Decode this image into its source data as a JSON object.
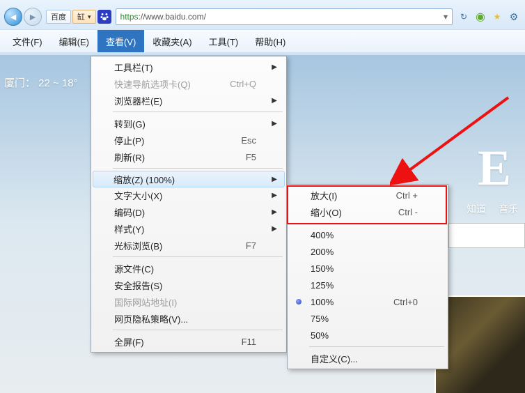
{
  "chrome": {
    "tab1": "百度",
    "tab2": "缸",
    "url_proto": "https",
    "url_rest": "://www.baidu.com/"
  },
  "menubar": {
    "file": "文件(F)",
    "edit": "编辑(E)",
    "view": "查看(V)",
    "fav": "收藏夹(A)",
    "tools": "工具(T)",
    "help": "帮助(H)"
  },
  "bg": {
    "weather": "厦门：    22 ~ 18°",
    "big_letter": "E",
    "link1": "知道",
    "link2": "音乐"
  },
  "viewMenu": {
    "toolbars": "工具栏(T)",
    "quicktabs": "快速导航选项卡(Q)",
    "quicktabs_sc": "Ctrl+Q",
    "explorerbar": "浏览器栏(E)",
    "goto": "转到(G)",
    "stop": "停止(P)",
    "stop_sc": "Esc",
    "refresh": "刷新(R)",
    "refresh_sc": "F5",
    "zoom": "缩放(Z) (100%)",
    "textsize": "文字大小(X)",
    "encoding": "编码(D)",
    "style": "样式(Y)",
    "caret": "光标浏览(B)",
    "caret_sc": "F7",
    "source": "源文件(C)",
    "security": "安全报告(S)",
    "intl": "国际网站地址(I)",
    "privacy": "网页隐私策略(V)...",
    "fullscreen": "全屏(F)",
    "fullscreen_sc": "F11"
  },
  "zoomMenu": {
    "in": "放大(I)",
    "in_sc": "Ctrl +",
    "out": "缩小(O)",
    "out_sc": "Ctrl -",
    "p400": "400%",
    "p200": "200%",
    "p150": "150%",
    "p125": "125%",
    "p100": "100%",
    "p100_sc": "Ctrl+0",
    "p75": "75%",
    "p50": "50%",
    "custom": "自定义(C)..."
  }
}
